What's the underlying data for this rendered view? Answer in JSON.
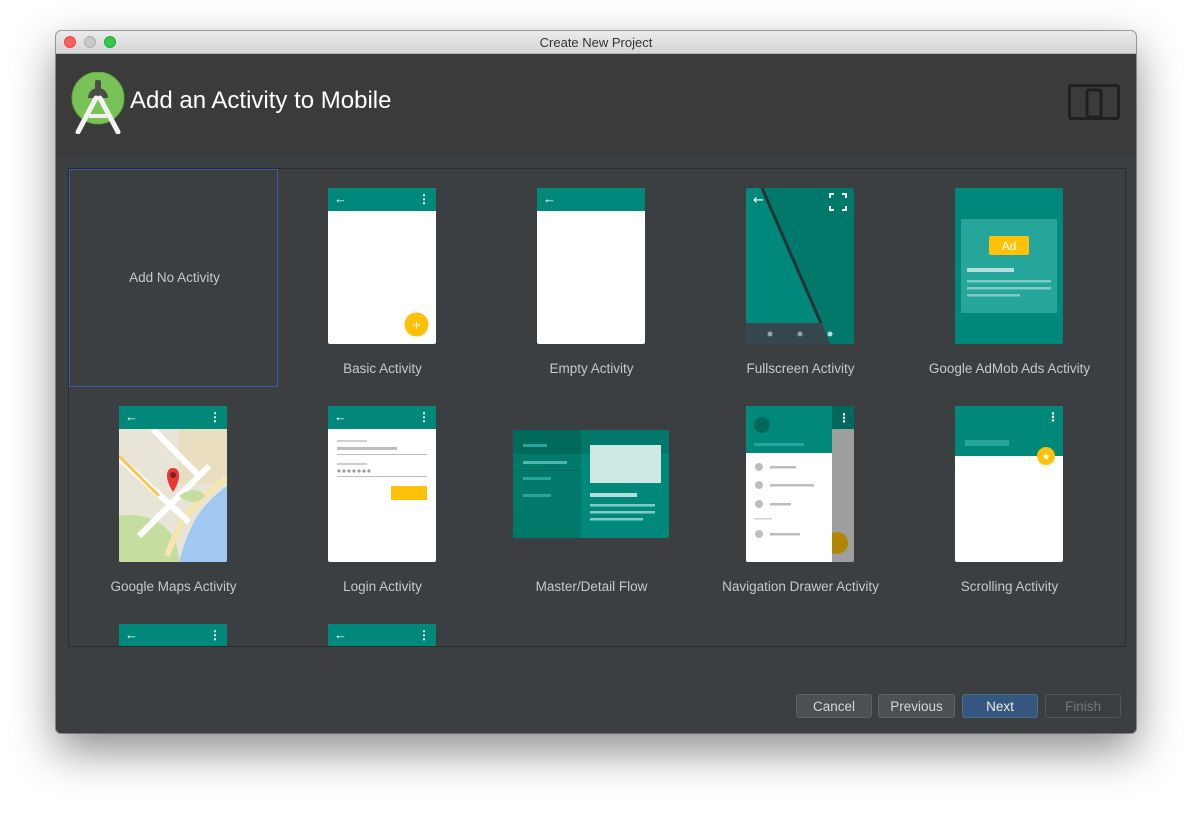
{
  "window": {
    "title": "Create New Project"
  },
  "header": {
    "title": "Add an Activity to Mobile",
    "logo_icon": "android-studio-logo-icon",
    "device_icon": "phone-tablet-icon"
  },
  "templates": [
    {
      "label": "Add No Activity"
    },
    {
      "label": "Basic Activity"
    },
    {
      "label": "Empty Activity"
    },
    {
      "label": "Fullscreen Activity"
    },
    {
      "label": "Google AdMob Ads Activity",
      "badge": "Ad"
    },
    {
      "label": "Google Maps Activity"
    },
    {
      "label": "Login Activity"
    },
    {
      "label": "Master/Detail Flow"
    },
    {
      "label": "Navigation Drawer Activity"
    },
    {
      "label": "Scrolling Activity"
    }
  ],
  "buttons": {
    "cancel": "Cancel",
    "previous": "Previous",
    "next": "Next",
    "finish": "Finish"
  },
  "colors": {
    "teal": "#00897b",
    "accent": "#ffc107",
    "selection": "#3d5aa8"
  }
}
